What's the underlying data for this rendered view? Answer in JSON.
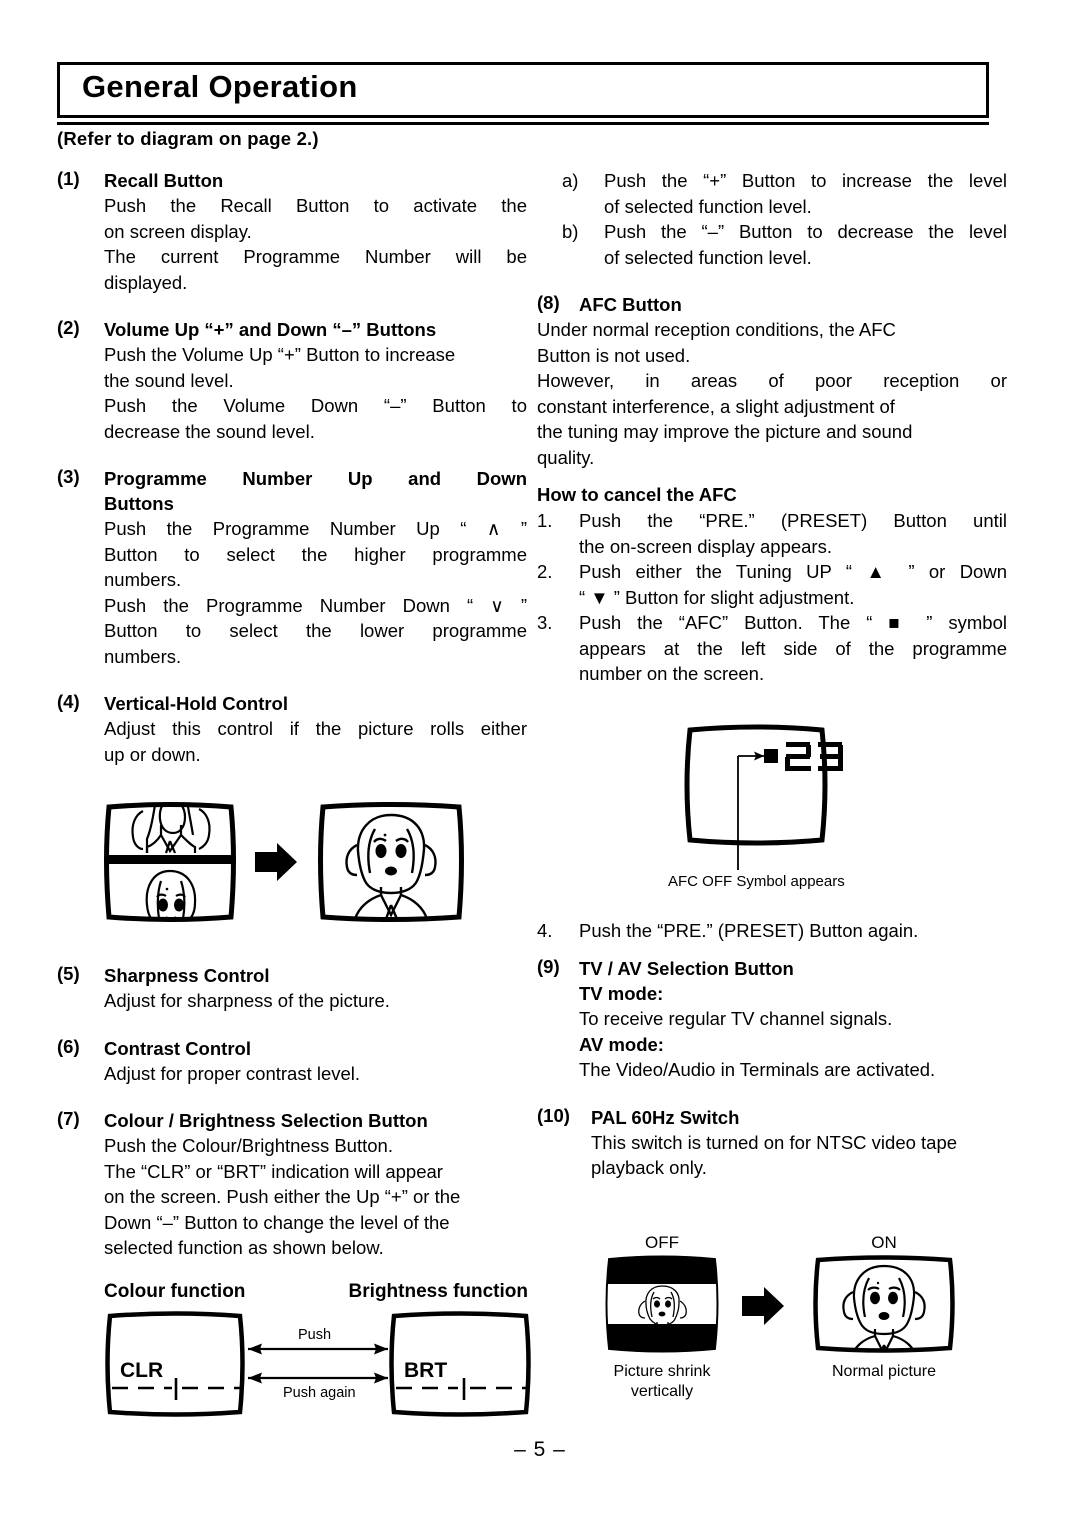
{
  "page": {
    "title": "General Operation",
    "refer_note": "(Refer to diagram on page 2.)",
    "page_number": "– 5 –"
  },
  "left_column": {
    "items": [
      {
        "number": "(1)",
        "heading": "Recall Button",
        "paragraphs": [
          "Push the Recall Button to activate the",
          "on  screen display.",
          "The current Programme Number will be",
          "displayed."
        ]
      },
      {
        "number": "(2)",
        "heading": "Volume Up “+” and Down “–” Buttons",
        "paragraphs": [
          "Push the Volume Up “+” Button to increase",
          "the sound level.",
          "Push the Volume Down “–” Button to",
          "decrease the sound level."
        ]
      },
      {
        "number": "(3)",
        "heading": "Programme Number Up and Down Buttons",
        "heading_line1": "Programme  Number  Up  and  Down",
        "heading_line2": "Buttons",
        "paragraphs": [
          "Push the Programme Number Up “ ∧ ”",
          "Button to select the higher programme",
          "numbers.",
          "Push the Programme Number Down “ ∨ ”",
          "Button to select the lower programme",
          "numbers."
        ]
      },
      {
        "number": "(4)",
        "heading": "Vertical-Hold Control",
        "paragraphs": [
          "Adjust this control if the picture rolls either",
          "up or down."
        ]
      },
      {
        "number": "(5)",
        "heading": "Sharpness Control",
        "paragraphs": [
          "Adjust for sharpness of the picture."
        ]
      },
      {
        "number": "(6)",
        "heading": "Contrast Control",
        "paragraphs": [
          "Adjust for proper contrast level."
        ]
      },
      {
        "number": "(7)",
        "heading": "Colour / Brightness Selection Button",
        "paragraphs": [
          "Push the Colour/Brightness Button.",
          "The “CLR” or “BRT” indication will appear",
          "on the screen. Push either the Up “+” or the",
          "Down “–” Button to change the level of the",
          "selected function as shown below."
        ]
      }
    ],
    "vertical_hold_figure": {
      "name": "vertical-hold-rolling-to-stable"
    },
    "function_figure": {
      "left_label": "Colour function",
      "right_label": "Brightness function",
      "left_screen_text": "CLR",
      "right_screen_text": "BRT",
      "arrow_top_label": "Push",
      "arrow_bottom_label": "Push again"
    }
  },
  "right_column": {
    "sub_items_ab": [
      {
        "marker": "a)",
        "lines": [
          "Push the “+” Button to increase the level",
          "of selected function level."
        ]
      },
      {
        "marker": "b)",
        "lines": [
          "Push the “–” Button to decrease the level",
          "of selected function level."
        ]
      }
    ],
    "items": [
      {
        "number": "(8)",
        "heading": "AFC Button",
        "paragraphs": [
          "Under normal reception conditions, the AFC",
          "Button is not used.",
          "However, in areas of  poor reception or",
          "constant interference, a slight adjustment of",
          "the tuning may improve the picture and sound",
          "quality."
        ]
      }
    ],
    "afc_cancel": {
      "heading": "How to cancel the AFC",
      "steps": [
        {
          "marker": "1.",
          "lines": [
            "Push the “PRE.” (PRESET) Button until",
            "the on-screen display appears."
          ]
        },
        {
          "marker": "2.",
          "lines": [
            "Push either the Tuning UP “ ▲ ” or Down",
            "“ ▼ ” Button for slight adjustment."
          ]
        },
        {
          "marker": "3.",
          "lines": [
            "Push the “AFC” Button. The “ ■ ” symbol",
            "appears at the left side of the programme",
            "number on the screen."
          ]
        }
      ],
      "step4": {
        "marker": "4.",
        "lines": [
          "Push the “PRE.” (PRESET) Button again."
        ]
      }
    },
    "afc_figure": {
      "screen_symbol": "■",
      "screen_number": "23",
      "caption": "AFC OFF Symbol appears"
    },
    "items_2": [
      {
        "number": "(9)",
        "heading": "TV / AV Selection Button",
        "sub_heading_1": "TV mode:",
        "sub_line_1": "To receive regular TV channel signals.",
        "sub_heading_2": "AV mode:",
        "sub_line_2": "The Video/Audio in Terminals are activated."
      },
      {
        "number": "(10)",
        "heading": "PAL 60Hz Switch",
        "paragraphs": [
          "This switch is turned on for NTSC video tape",
          "playback only."
        ]
      }
    ],
    "pal_figure": {
      "left_label": "OFF",
      "right_label": "ON",
      "left_caption_line1": "Picture shrink",
      "left_caption_line2": "vertically",
      "right_caption": "Normal picture"
    }
  }
}
